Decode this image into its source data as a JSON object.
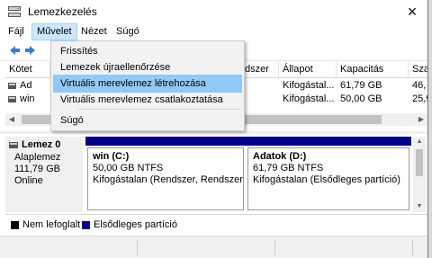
{
  "window": {
    "title": "Lemezkezelés",
    "close_glyph": "×"
  },
  "menubar": {
    "items": [
      "Fájl",
      "Művelet",
      "Nézet",
      "Súgó"
    ]
  },
  "dropdown": {
    "items": [
      "Frissítés",
      "Lemezek újraellenőrzése",
      "Virtuális merevlemez létrehozása",
      "Virtuális merevlemez csatlakoztatása",
      "Súgó"
    ],
    "highlighted_index": 2
  },
  "volume_table": {
    "headers": [
      "Kötet",
      "dszer",
      "Állapot",
      "Kapacitás",
      "Sza"
    ],
    "rows": [
      {
        "name": "Ad",
        "status": "Kifogástal...",
        "capacity": "61,79 GB",
        "free": "46,"
      },
      {
        "name": "win",
        "status": "Kifogástal...",
        "capacity": "50,00 GB",
        "free": "25,9"
      }
    ]
  },
  "disk": {
    "name": "Lemez 0",
    "type": "Alaplemez",
    "size": "111,79 GB",
    "state": "Online"
  },
  "partitions": [
    {
      "title": "win  (C:)",
      "detail": "50,00 GB NTFS",
      "status": "Kifogástalan (Rendszer, Rendszerindít"
    },
    {
      "title": "Adatok  (D:)",
      "detail": "61,79 GB NTFS",
      "status": "Kifogástalan (Elsődleges partíció)"
    }
  ],
  "legend": [
    {
      "label": "Nem lefoglalt",
      "color": "#000000"
    },
    {
      "label": "Elsődleges partíció",
      "color": "#00008b"
    }
  ],
  "colors": {
    "partition_bar": "#00008b",
    "menu_highlight": "#91c9f7",
    "menu_open": "#cce8ff"
  }
}
